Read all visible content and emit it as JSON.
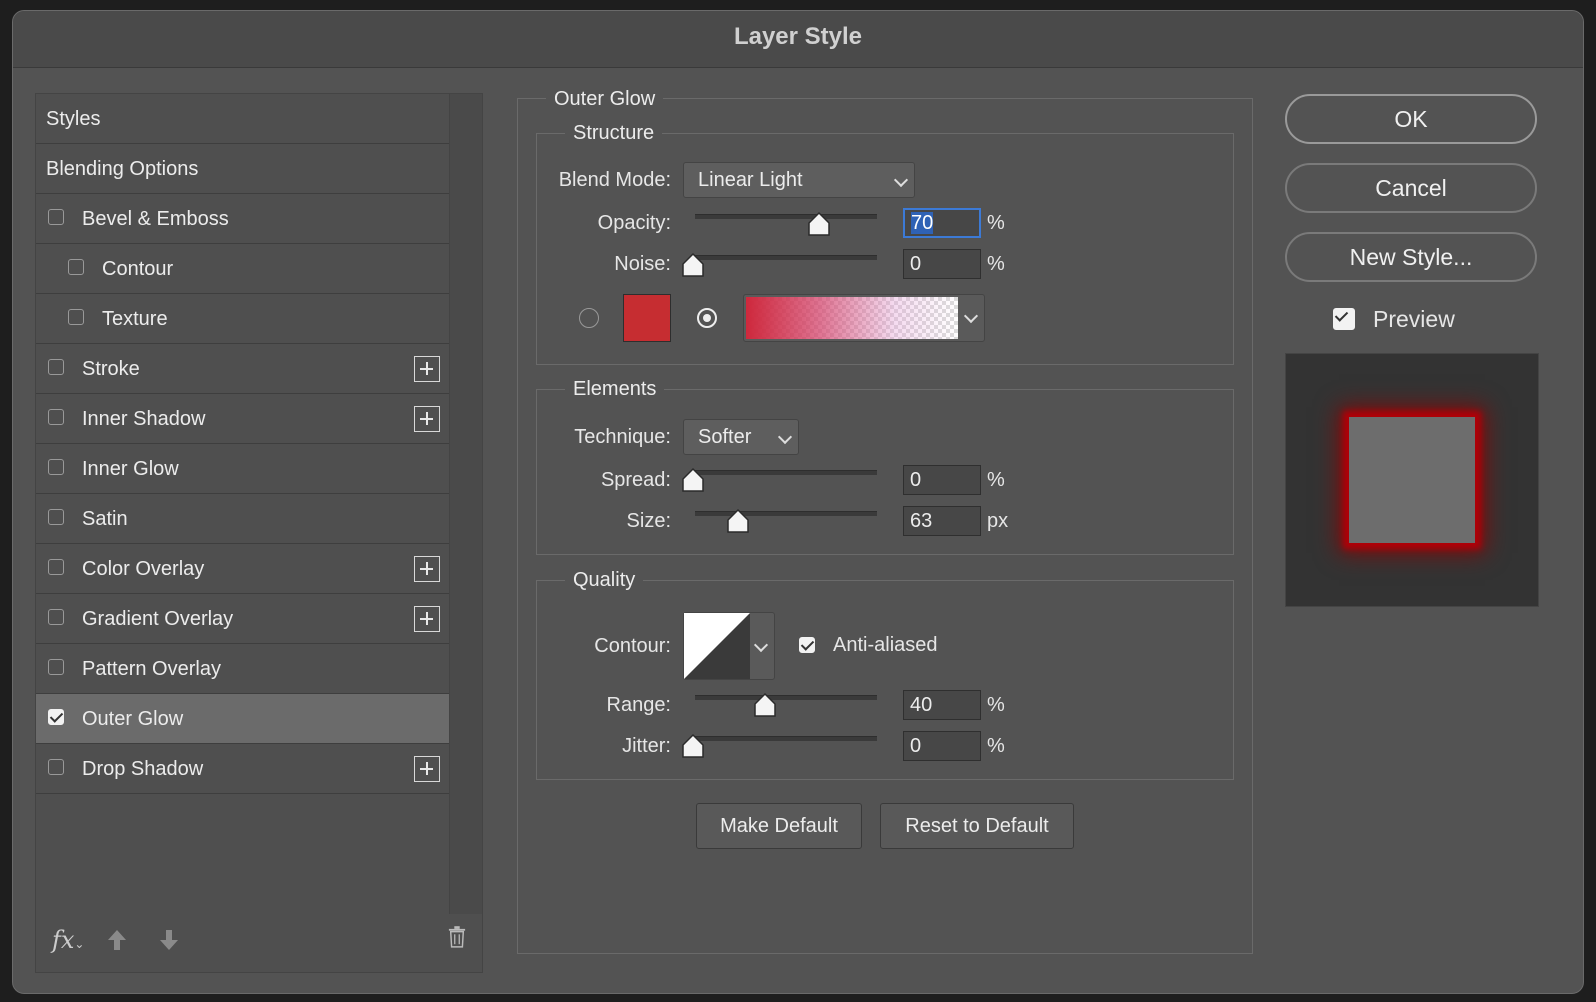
{
  "dialog": {
    "title": "Layer Style"
  },
  "styles_panel": {
    "items": [
      {
        "label": "Styles",
        "type": "header"
      },
      {
        "label": "Blending Options",
        "type": "header"
      },
      {
        "label": "Bevel & Emboss",
        "checked": false,
        "plus": false
      },
      {
        "label": "Contour",
        "checked": false,
        "plus": false,
        "sub": true
      },
      {
        "label": "Texture",
        "checked": false,
        "plus": false,
        "sub": true
      },
      {
        "label": "Stroke",
        "checked": false,
        "plus": true
      },
      {
        "label": "Inner Shadow",
        "checked": false,
        "plus": true
      },
      {
        "label": "Inner Glow",
        "checked": false,
        "plus": false
      },
      {
        "label": "Satin",
        "checked": false,
        "plus": false
      },
      {
        "label": "Color Overlay",
        "checked": false,
        "plus": true
      },
      {
        "label": "Gradient Overlay",
        "checked": false,
        "plus": true
      },
      {
        "label": "Pattern Overlay",
        "checked": false,
        "plus": false
      },
      {
        "label": "Outer Glow",
        "checked": true,
        "plus": false,
        "selected": true
      },
      {
        "label": "Drop Shadow",
        "checked": false,
        "plus": true
      }
    ],
    "footer": {
      "fx_label": "fx",
      "icons": [
        "fx-menu-icon",
        "move-up-icon",
        "move-down-icon",
        "trash-icon"
      ]
    }
  },
  "outer_glow": {
    "section_title": "Outer Glow",
    "structure": {
      "title": "Structure",
      "blend_mode_label": "Blend Mode:",
      "blend_mode_value": "Linear Light",
      "opacity_label": "Opacity:",
      "opacity_value": "70",
      "opacity_unit": "%",
      "opacity_fraction": 0.7,
      "noise_label": "Noise:",
      "noise_value": "0",
      "noise_unit": "%",
      "noise_fraction": 0,
      "color_swatch": "#c62d31",
      "fill_mode": "gradient"
    },
    "elements": {
      "title": "Elements",
      "technique_label": "Technique:",
      "technique_value": "Softer",
      "spread_label": "Spread:",
      "spread_value": "0",
      "spread_unit": "%",
      "spread_fraction": 0,
      "size_label": "Size:",
      "size_value": "63",
      "size_unit": "px",
      "size_fraction": 0.25
    },
    "quality": {
      "title": "Quality",
      "contour_label": "Contour:",
      "anti_aliased_label": "Anti-aliased",
      "anti_aliased": true,
      "range_label": "Range:",
      "range_value": "40",
      "range_unit": "%",
      "range_fraction": 0.4,
      "jitter_label": "Jitter:",
      "jitter_value": "0",
      "jitter_unit": "%",
      "jitter_fraction": 0
    },
    "make_default_label": "Make Default",
    "reset_default_label": "Reset to Default"
  },
  "actions": {
    "ok_label": "OK",
    "cancel_label": "Cancel",
    "new_style_label": "New Style...",
    "preview_label": "Preview",
    "preview_checked": true
  },
  "colors": {
    "glow": "#b00008",
    "accent": "#3c7ad6"
  }
}
